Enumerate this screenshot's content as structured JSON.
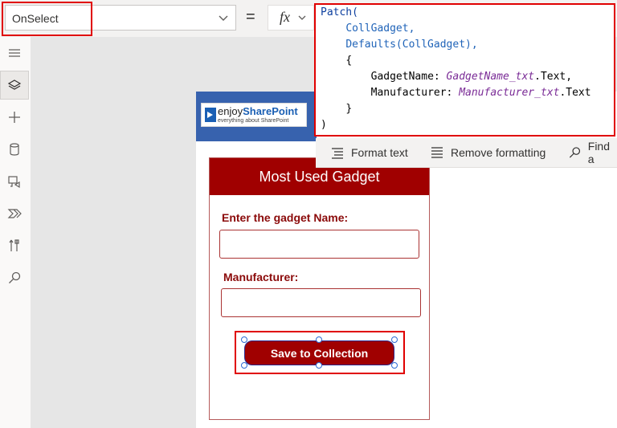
{
  "formula_bar": {
    "property": "OnSelect",
    "equals": "=",
    "fx": "fx"
  },
  "formula": {
    "line1_fn": "Patch(",
    "line2": "CollGadget,",
    "line3": "Defaults(CollGadget),",
    "line4": "{",
    "line5_key": "GadgetName:",
    "line5_ctrl": "GadgetName_txt",
    "line5_prop": ".Text,",
    "line6_key": "Manufacturer:",
    "line6_ctrl": "Manufacturer_txt",
    "line6_prop": ".Text",
    "line7": "}",
    "line8": ")"
  },
  "formula_toolbar": {
    "format_text": "Format text",
    "remove_formatting": "Remove formatting",
    "find": "Find a"
  },
  "rail": {
    "items": [
      "hamburger-menu-icon",
      "layers-icon",
      "plus-icon",
      "database-icon",
      "media-icon",
      "power-automate-icon",
      "tools-icon",
      "search-icon"
    ]
  },
  "logo": {
    "enjoy": "enjoy",
    "sharepoint": "SharePoint",
    "tagline": "everything about SharePoint"
  },
  "card": {
    "title": "Most Used Gadget",
    "gadget_label": "Enter the gadget Name:",
    "manufacturer_label": "Manufacturer:",
    "save_button": "Save to Collection"
  },
  "colors": {
    "header_red": "#a00000",
    "logo_blue": "#3762ae",
    "highlight_red": "#e00000"
  }
}
